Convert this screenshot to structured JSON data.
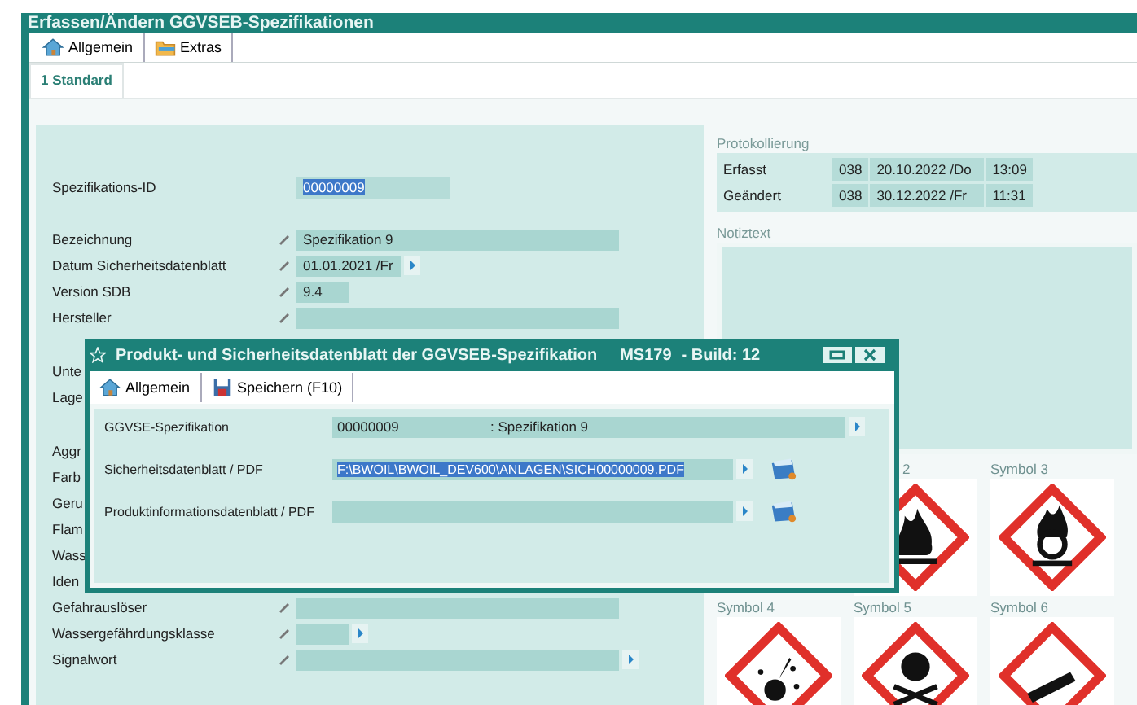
{
  "window": {
    "title": "Erfassen/Ändern GGVSEB-Spezifikationen"
  },
  "toolbar": [
    {
      "label": "Allgemein",
      "kind": "home"
    },
    {
      "label": "Extras",
      "kind": "folder"
    }
  ],
  "tabs": [
    {
      "label": "1 Standard",
      "selected": true
    }
  ],
  "form_groups": [
    [
      {
        "label": "Spezifikations-ID",
        "kind": "id",
        "value": "00000009",
        "selected": true
      }
    ],
    [
      {
        "label": "Bezeichnung",
        "kind": "long",
        "value": "Spezifikation 9"
      },
      {
        "label": "Datum Sicherheitsdatenblatt",
        "kind": "date",
        "value": "01.01.2021 /Fr"
      },
      {
        "label": "Version SDB",
        "kind": "short",
        "value": "9.4"
      },
      {
        "label": "Hersteller",
        "kind": "long"
      }
    ],
    [
      {
        "label": "Unte",
        "kind": "covered"
      },
      {
        "label": "Lage",
        "kind": "covered"
      }
    ],
    [
      {
        "label": "Aggr",
        "kind": "covered"
      },
      {
        "label": "Farb",
        "kind": "covered"
      },
      {
        "label": "Geru",
        "kind": "covered"
      },
      {
        "label": "Flam",
        "kind": "covered"
      },
      {
        "label": "Wass",
        "kind": "covered"
      },
      {
        "label": "Iden",
        "kind": "covered"
      },
      {
        "label": "Gefahrauslöser",
        "kind": "long"
      },
      {
        "label": "Wassergefährdungsklasse",
        "kind": "short-select"
      },
      {
        "label": "Signalwort",
        "kind": "long-select"
      }
    ]
  ],
  "protokollierung": {
    "title": "Protokollierung",
    "rows": [
      {
        "label": "Erfasst",
        "user": "038",
        "date": "20.10.2022 /Do",
        "time": "13:09"
      },
      {
        "label": "Geändert",
        "user": "038",
        "date": "30.12.2022 /Fr",
        "time": "11:31"
      }
    ]
  },
  "notiztext": {
    "title": "Notiztext"
  },
  "symbols": [
    {
      "label": "2",
      "kind": "flame"
    },
    {
      "label": "Symbol 3",
      "kind": "oxidizer"
    },
    {
      "label": "Symbol 4",
      "kind": "explosive"
    },
    {
      "label": "Symbol 5",
      "kind": "skull"
    },
    {
      "label": "Symbol 6",
      "kind": "gas"
    }
  ],
  "dialog": {
    "title": "Produkt- und Sicherheitsdatenblatt der GGVSEB-Spezifikation",
    "code": "MS179",
    "build": "- Build: 12",
    "toolbar": [
      {
        "label": "Allgemein",
        "kind": "home"
      },
      {
        "label": "Speichern (F10)",
        "kind": "disk"
      }
    ],
    "rows": [
      {
        "label": "GGVSE-Spezifikation",
        "kind": "reference",
        "value": "00000009",
        "description": ": Spezifikation 9"
      },
      {
        "label": "Sicherheitsdatenblatt / PDF",
        "kind": "file",
        "value": "F:\\BWOIL\\BWOIL_DEV600\\ANLAGEN\\SICH00000009.PDF",
        "selected": true
      },
      {
        "label": "Produktinformationsdatenblatt / PDF",
        "kind": "file"
      }
    ]
  }
}
